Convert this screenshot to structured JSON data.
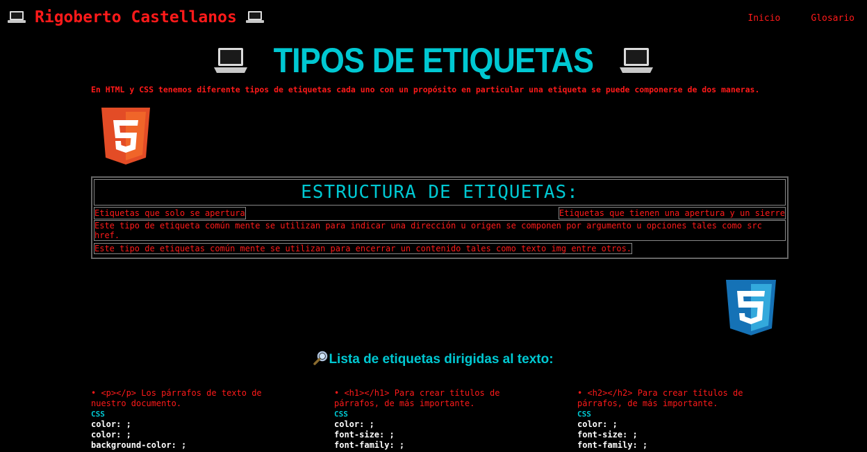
{
  "header": {
    "brand": "Rigoberto Castellanos",
    "nav": [
      "Inicio",
      "Glosario"
    ]
  },
  "main": {
    "title": "TIPOS DE ETIQUETAS",
    "intro": "En HTML y CSS tenemos diferente tipos de etiquetas cada uno con un propósito en particular una etiqueta se puede componerse de dos maneras."
  },
  "structure": {
    "title": "ESTRUCTURA DE ETIQUETAS:",
    "left_header": "Etiquetas que solo se apertura",
    "right_header": "Etiquetas que tienen una apertura y un sierre",
    "desc1": "Este tipo de etiqueta común mente se utilizan para indicar una dirección u origen se componen por argumento u opciones tales como src href.",
    "desc2": "Este tipo de etiquetas común mente se utilizan para encerrar un contenido tales como texto img entre otros."
  },
  "list": {
    "title": "Lista de etiquetas dirigidas al texto:",
    "columns": [
      {
        "item": "•  <p></p> Los párrafos de texto de nuestro documento.",
        "css_label": "CSS",
        "props": [
          "color: ;",
          "color: ;",
          "background-color: ;"
        ]
      },
      {
        "item": "•  <h1></h1> Para crear títulos de párrafos, de más importante.",
        "css_label": "CSS",
        "props": [
          "color: ;",
          "font-size: ;",
          "font-family: ;"
        ]
      },
      {
        "item": "•  <h2></h2> Para crear títulos de párrafos, de más importante.",
        "css_label": "CSS",
        "props": [
          "color: ;",
          "font-size: ;",
          "font-family: ;"
        ]
      }
    ]
  },
  "colors": {
    "accent_red": "#ff1a1a",
    "accent_cyan": "#00c8d2",
    "background": "#000000"
  }
}
